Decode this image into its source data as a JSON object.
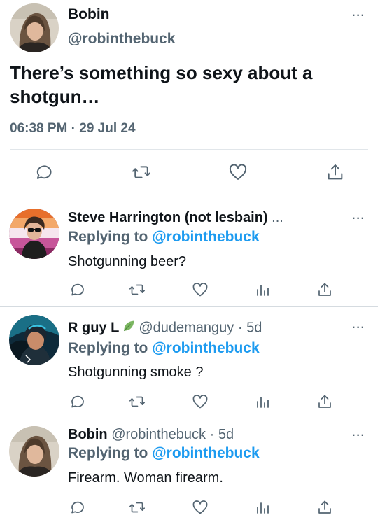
{
  "main_tweet": {
    "author_name": "Bobin",
    "author_handle": "@robinthebuck",
    "text": "There’s something so sexy about a shotgun…",
    "timestamp": "06:38 PM · 29 Jul 24",
    "more": "···",
    "actions": [
      "reply-icon",
      "retweet-icon",
      "like-icon",
      "share-icon"
    ]
  },
  "replies": [
    {
      "author_name": "Steve Harrington (not lesbain)",
      "author_handle": "",
      "age": "",
      "truncation": "...",
      "replying_prefix": "Replying to",
      "replying_to": "@robinthebuck",
      "text": "Shotgunning beer?",
      "more": "···",
      "actions": [
        "reply-icon",
        "retweet-icon",
        "like-icon",
        "views-icon",
        "share-icon"
      ]
    },
    {
      "author_name": "R guy L",
      "author_handle": "@dudemanguy",
      "age": "· 5d",
      "badge": "leaf-icon",
      "replying_prefix": "Replying to",
      "replying_to": "@robinthebuck",
      "text": "Shotgunning smoke ?",
      "more": "···",
      "actions": [
        "reply-icon",
        "retweet-icon",
        "like-icon",
        "views-icon",
        "share-icon"
      ]
    },
    {
      "author_name": "Bobin",
      "author_handle": "@robinthebuck",
      "age": "· 5d",
      "replying_prefix": "Replying to",
      "replying_to": "@robinthebuck",
      "text": "Firearm. Woman firearm.",
      "more": "···",
      "actions": [
        "reply-icon",
        "retweet-icon",
        "like-icon",
        "views-icon",
        "share-icon"
      ]
    }
  ],
  "colors": {
    "text": "#0f1419",
    "muted": "#536471",
    "link": "#1d9bf0",
    "divider": "#e1e6ea"
  }
}
